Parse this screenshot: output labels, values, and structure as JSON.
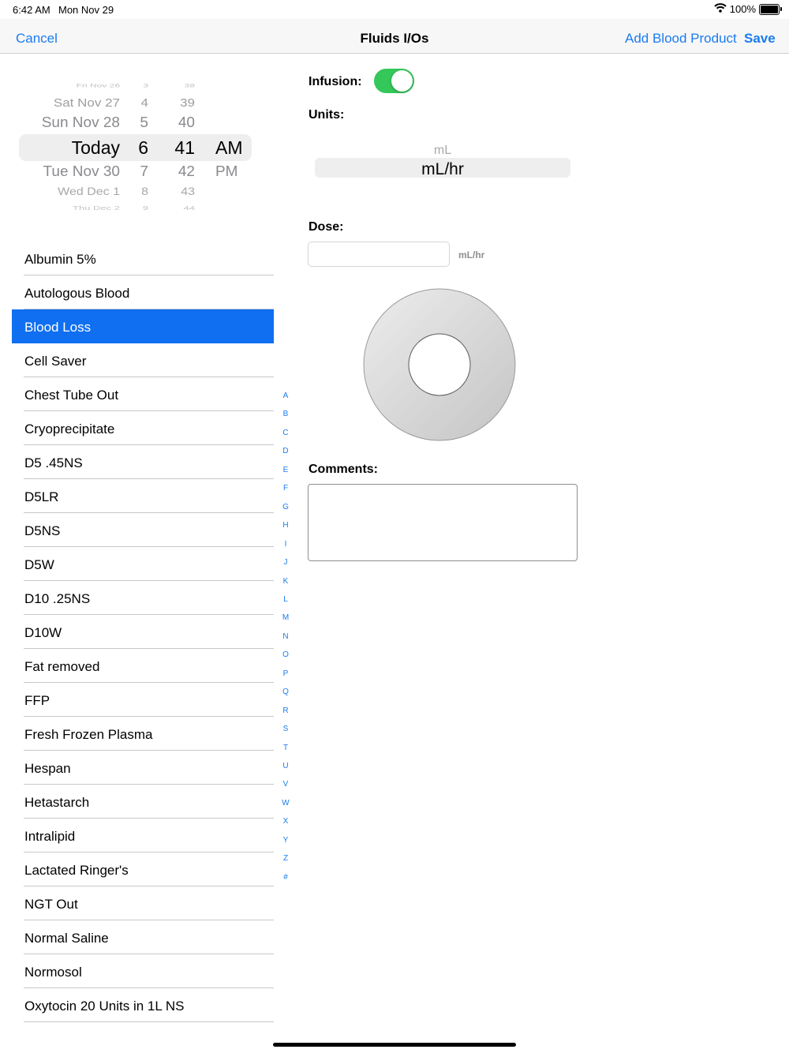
{
  "status": {
    "time": "6:42 AM",
    "date": "Mon Nov 29",
    "battery": "100%"
  },
  "nav": {
    "cancel": "Cancel",
    "title": "Fluids I/Os",
    "add": "Add Blood Product",
    "save": "Save"
  },
  "picker": {
    "rows": [
      {
        "day": "Fri Nov 26",
        "hour": "3",
        "minute": "38",
        "ampm": ""
      },
      {
        "day": "Sat Nov 27",
        "hour": "4",
        "minute": "39",
        "ampm": ""
      },
      {
        "day": "Sun Nov 28",
        "hour": "5",
        "minute": "40",
        "ampm": ""
      },
      {
        "day": "Today",
        "hour": "6",
        "minute": "41",
        "ampm": "AM"
      },
      {
        "day": "Tue Nov 30",
        "hour": "7",
        "minute": "42",
        "ampm": "PM"
      },
      {
        "day": "Wed Dec 1",
        "hour": "8",
        "minute": "43",
        "ampm": ""
      },
      {
        "day": "Thu Dec 2",
        "hour": "9",
        "minute": "44",
        "ampm": ""
      }
    ]
  },
  "fluids": [
    "Albumin 5%",
    "Autologous Blood",
    "Blood Loss",
    "Cell Saver",
    "Chest Tube Out",
    "Cryoprecipitate",
    "D5 .45NS",
    "D5LR",
    "D5NS",
    "D5W",
    "D10 .25NS",
    "D10W",
    "Fat removed",
    "FFP",
    "Fresh Frozen Plasma",
    "Hespan",
    "Hetastarch",
    "Intralipid",
    "Lactated Ringer's",
    "NGT Out",
    "Normal Saline",
    "Normosol",
    "Oxytocin 20 Units in 1L NS"
  ],
  "selected_fluid": "Blood Loss",
  "index_letters": [
    "A",
    "B",
    "C",
    "D",
    "E",
    "F",
    "G",
    "H",
    "I",
    "J",
    "K",
    "L",
    "M",
    "N",
    "O",
    "P",
    "Q",
    "R",
    "S",
    "T",
    "U",
    "V",
    "W",
    "X",
    "Y",
    "Z",
    "#"
  ],
  "form": {
    "infusion_label": "Infusion:",
    "infusion_on": true,
    "units_label": "Units:",
    "units_options": [
      "mL",
      "mL/hr"
    ],
    "units_selected": "mL/hr",
    "dose_label": "Dose:",
    "dose_value": "",
    "dose_unit": "mL/hr",
    "comments_label": "Comments:",
    "comments_value": ""
  },
  "colors": {
    "accent": "#1a7cf0",
    "selected_row": "#0f6ff0",
    "toggle_on": "#34c759"
  }
}
